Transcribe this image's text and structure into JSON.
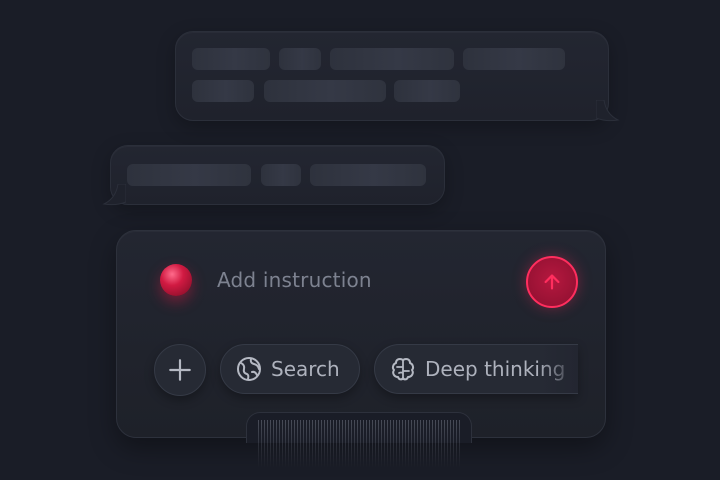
{
  "composer": {
    "instruction_placeholder": "Add instruction",
    "send_icon": "arrow-up-icon",
    "actions": {
      "add_icon": "plus-icon",
      "search_label": "Search",
      "search_icon": "globe-icon",
      "deep_label": "Deep thinking",
      "deep_icon": "brain-icon"
    }
  },
  "colors": {
    "background": "#1a1d27",
    "accent": "#ff2e5e",
    "record_dot": "#d11a42"
  }
}
